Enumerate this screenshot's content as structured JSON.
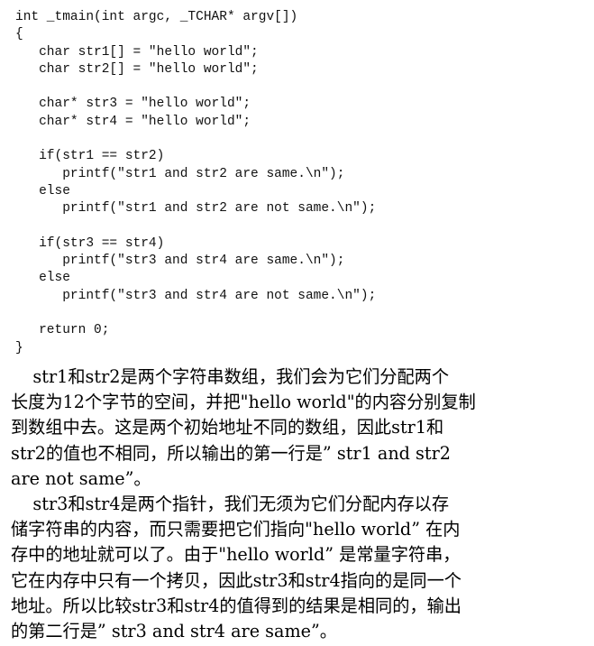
{
  "code": {
    "lines": [
      "int _tmain(int argc, _TCHAR* argv[])",
      "{",
      "   char str1[] = \"hello world\";",
      "   char str2[] = \"hello world\";",
      "",
      "   char* str3 = \"hello world\";",
      "   char* str4 = \"hello world\";",
      "",
      "   if(str1 == str2)",
      "      printf(\"str1 and str2 are same.\\n\");",
      "   else",
      "      printf(\"str1 and str2 are not same.\\n\");",
      "",
      "   if(str3 == str4)",
      "      printf(\"str3 and str4 are same.\\n\");",
      "   else",
      "      printf(\"str3 and str4 are not same.\\n\");",
      "",
      "   return 0;",
      "}"
    ]
  },
  "explanation": {
    "lines": [
      "    str1和str2是两个字符串数组，我们会为它们分配两个",
      "长度为12个字节的空间，并把\"hello world\"的内容分别复制",
      "到数组中去。这是两个初始地址不同的数组，因此str1和",
      "str2的值也不相同，所以输出的第一行是” str1 and str2",
      "are not same”。",
      "    str3和str4是两个指针，我们无须为它们分配内存以存",
      "储字符串的内容，而只需要把它们指向\"hello world” 在内",
      "存中的地址就可以了。由于\"hello world” 是常量字符串，",
      "它在内存中只有一个拷贝，因此str3和str4指向的是同一个",
      "地址。所以比较str3和str4的值得到的结果是相同的，输出",
      "的第二行是” str3 and str4 are same”。"
    ]
  }
}
